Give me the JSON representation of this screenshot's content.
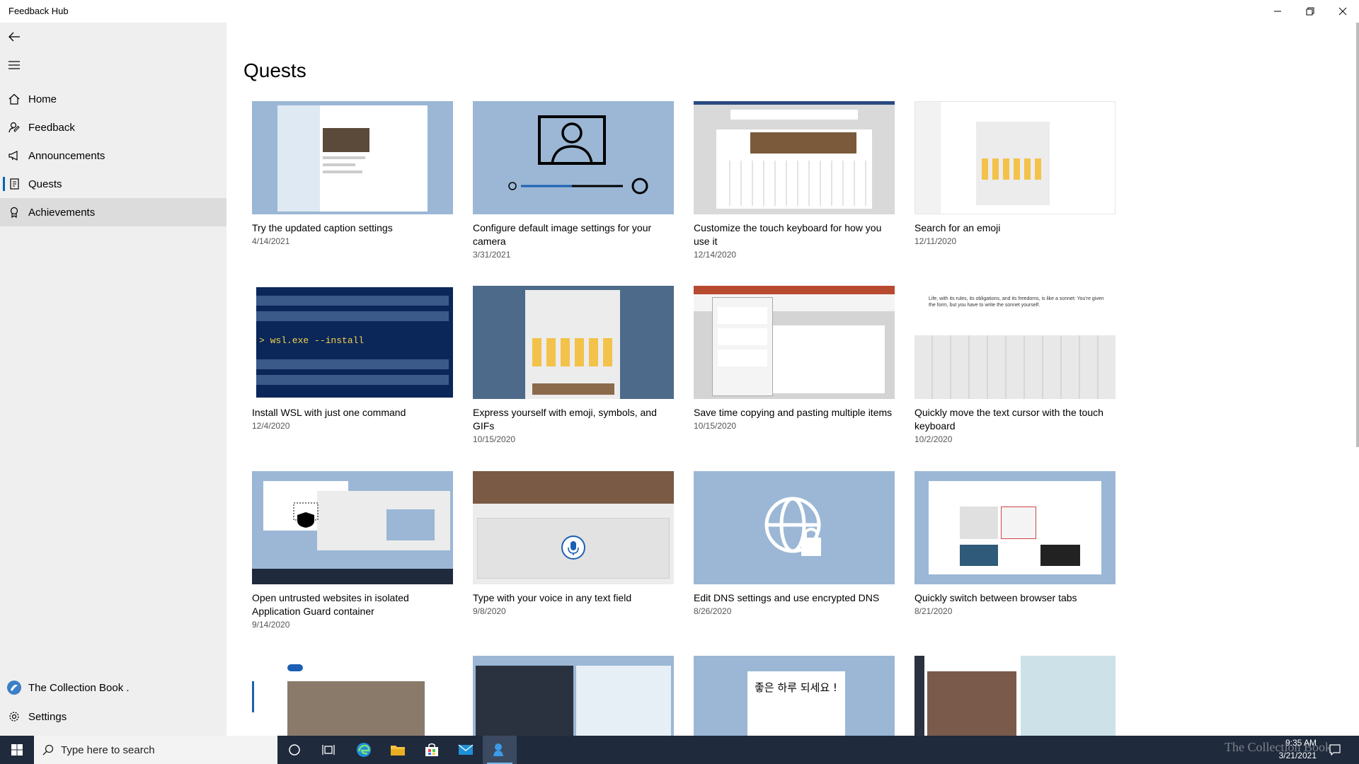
{
  "window": {
    "title": "Feedback Hub"
  },
  "sidebar": {
    "items": [
      {
        "label": "Home",
        "icon": "home-icon"
      },
      {
        "label": "Feedback",
        "icon": "feedback-icon"
      },
      {
        "label": "Announcements",
        "icon": "megaphone-icon"
      },
      {
        "label": "Quests",
        "icon": "quests-icon",
        "selected": true
      },
      {
        "label": "Achievements",
        "icon": "medal-icon"
      }
    ],
    "account_label": "The Collection Book .",
    "settings_label": "Settings"
  },
  "main": {
    "page_title": "Quests",
    "quests": [
      {
        "title": "Try the updated caption settings",
        "date": "4/14/2021"
      },
      {
        "title": "Configure default image settings for your camera",
        "date": "3/31/2021"
      },
      {
        "title": "Customize the touch keyboard for how you use it",
        "date": "12/14/2020"
      },
      {
        "title": "Search for an emoji",
        "date": "12/11/2020"
      },
      {
        "title": "Install WSL with just one command",
        "date": "12/4/2020",
        "thumb_text": "> wsl.exe --install"
      },
      {
        "title": "Express yourself with emoji, symbols, and GIFs",
        "date": "10/15/2020"
      },
      {
        "title": "Save time copying and pasting multiple items",
        "date": "10/15/2020"
      },
      {
        "title": "Quickly move the text cursor with the touch keyboard",
        "date": "10/2/2020",
        "thumb_text": "Life, with its rules, its obligations, and its freedoms, is like a sonnet: You're given the form, but you have to write the sonnet yourself."
      },
      {
        "title": "Open untrusted websites in isolated Application Guard container",
        "date": "9/14/2020"
      },
      {
        "title": "Type with your voice in any text field",
        "date": "9/8/2020"
      },
      {
        "title": "Edit DNS settings and use encrypted DNS",
        "date": "8/26/2020"
      },
      {
        "title": "Quickly switch between browser tabs",
        "date": "8/21/2020"
      },
      {
        "title": "",
        "date": ""
      },
      {
        "title": "",
        "date": ""
      },
      {
        "title": "",
        "date": "",
        "thumb_text": "좋은 하루 되세요 !"
      },
      {
        "title": "",
        "date": ""
      }
    ]
  },
  "taskbar": {
    "search_placeholder": "Type here to search",
    "time": "9:35 AM",
    "date": "3/21/2021",
    "watermark": "The Collection Book"
  },
  "colors": {
    "accent": "#0063b1",
    "thumb_blue": "#9bb7d5",
    "thumb_dark_blue": "#0b2659",
    "taskbar": "#1f2a3c",
    "sidebar": "#efefef"
  }
}
